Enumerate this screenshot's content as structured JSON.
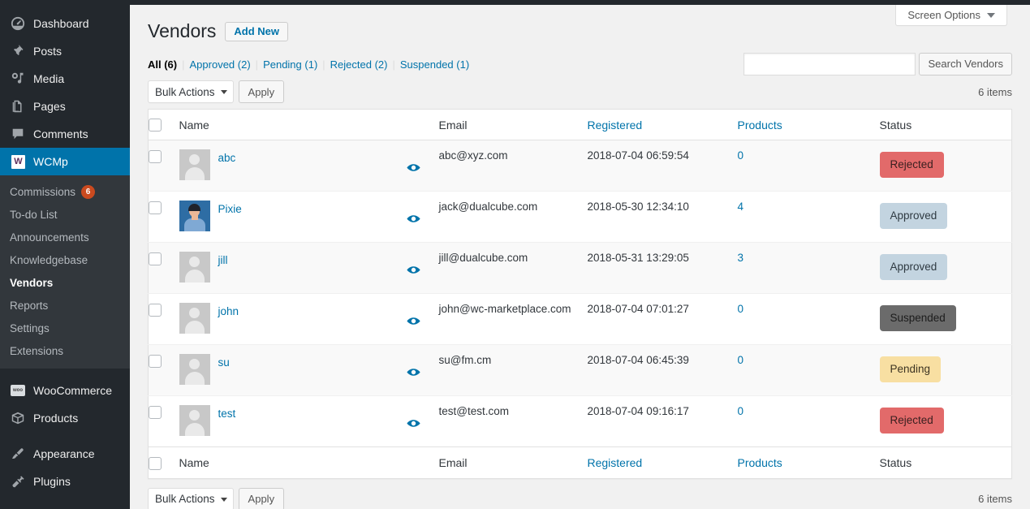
{
  "sidebar": {
    "items": [
      {
        "label": "Dashboard",
        "icon": "dashboard-icon",
        "current": false
      },
      {
        "label": "Posts",
        "icon": "pin-icon",
        "current": false
      },
      {
        "label": "Media",
        "icon": "media-icon",
        "current": false
      },
      {
        "label": "Pages",
        "icon": "pages-icon",
        "current": false
      },
      {
        "label": "Comments",
        "icon": "comment-icon",
        "current": false
      },
      {
        "label": "WCMp",
        "icon": "wcmp-logo-icon",
        "current": true
      },
      {
        "label": "WooCommerce",
        "icon": "woocommerce-icon",
        "current": false
      },
      {
        "label": "Products",
        "icon": "box-icon",
        "current": false
      },
      {
        "label": "Appearance",
        "icon": "brush-icon",
        "current": false
      },
      {
        "label": "Plugins",
        "icon": "plug-icon",
        "current": false
      }
    ],
    "submenu": [
      {
        "label": "Commissions",
        "badge": "6",
        "current": false
      },
      {
        "label": "To-do List",
        "badge": "",
        "current": false
      },
      {
        "label": "Announcements",
        "badge": "",
        "current": false
      },
      {
        "label": "Knowledgebase",
        "badge": "",
        "current": false
      },
      {
        "label": "Vendors",
        "badge": "",
        "current": true
      },
      {
        "label": "Reports",
        "badge": "",
        "current": false
      },
      {
        "label": "Settings",
        "badge": "",
        "current": false
      },
      {
        "label": "Extensions",
        "badge": "",
        "current": false
      }
    ]
  },
  "screen_meta": {
    "screen_options_label": "Screen Options"
  },
  "header": {
    "title": "Vendors",
    "add_new_label": "Add New"
  },
  "search": {
    "value": "",
    "placeholder": "",
    "button_label": "Search Vendors"
  },
  "filters": [
    {
      "label": "All (6)",
      "current": true
    },
    {
      "label": "Approved (2)",
      "current": false
    },
    {
      "label": "Pending (1)",
      "current": false
    },
    {
      "label": "Rejected (2)",
      "current": false
    },
    {
      "label": "Suspended (1)",
      "current": false
    }
  ],
  "tablenav_top": {
    "bulk_actions_label": "Bulk Actions",
    "apply_label": "Apply",
    "displaying_num": "6 items"
  },
  "tablenav_bottom": {
    "bulk_actions_label": "Bulk Actions",
    "apply_label": "Apply",
    "displaying_num": "6 items"
  },
  "table": {
    "columns": {
      "name": "Name",
      "email": "Email",
      "registered": "Registered",
      "products": "Products",
      "status": "Status"
    },
    "rows": [
      {
        "name": "abc",
        "avatar": "default-avatar",
        "email": "abc@xyz.com",
        "registered": "2018-07-04 06:59:54",
        "products": "0",
        "status": "Rejected",
        "status_key": "rejected"
      },
      {
        "name": "Pixie",
        "avatar": "photo-avatar",
        "email": "jack@dualcube.com",
        "registered": "2018-05-30 12:34:10",
        "products": "4",
        "status": "Approved",
        "status_key": "approved"
      },
      {
        "name": "jill",
        "avatar": "default-avatar",
        "email": "jill@dualcube.com",
        "registered": "2018-05-31 13:29:05",
        "products": "3",
        "status": "Approved",
        "status_key": "approved"
      },
      {
        "name": "john",
        "avatar": "default-avatar",
        "email": "john@wc-marketplace.com",
        "registered": "2018-07-04 07:01:27",
        "products": "0",
        "status": "Suspended",
        "status_key": "suspended"
      },
      {
        "name": "su",
        "avatar": "default-avatar",
        "email": "su@fm.cm",
        "registered": "2018-07-04 06:45:39",
        "products": "0",
        "status": "Pending",
        "status_key": "pending"
      },
      {
        "name": "test",
        "avatar": "default-avatar",
        "email": "test@test.com",
        "registered": "2018-07-04 09:16:17",
        "products": "0",
        "status": "Rejected",
        "status_key": "rejected"
      }
    ]
  },
  "colors": {
    "admin_bar": "#23282d",
    "sidebar_bg": "#23282d",
    "submenu_bg": "#32373c",
    "accent_blue": "#0073aa",
    "badge_orange": "#ca4a1f",
    "status_rejected": "#e26a6a",
    "status_approved": "#c3d4e0",
    "status_suspended": "#6b6b6b",
    "status_pending": "#f8dfa2",
    "content_bg": "#f1f1f1"
  }
}
